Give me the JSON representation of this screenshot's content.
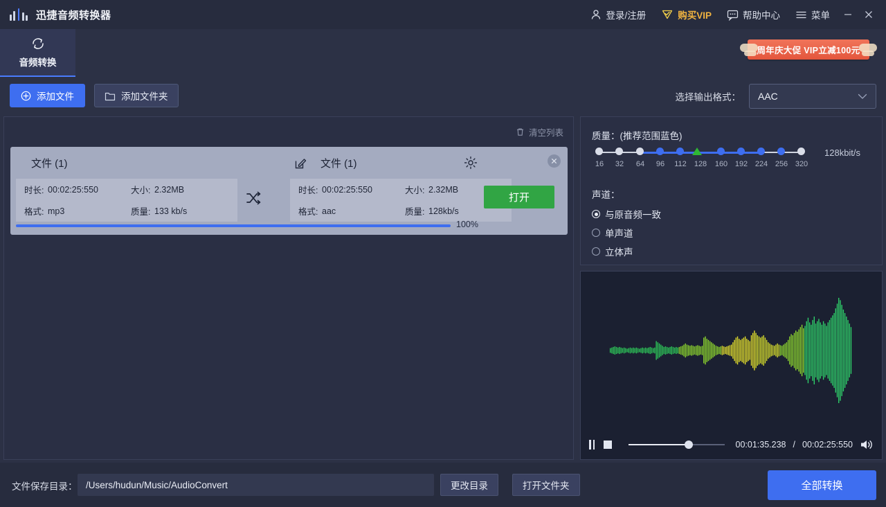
{
  "titlebar": {
    "app_title": "迅捷音频转换器",
    "login": "登录/注册",
    "vip": "购买VIP",
    "help": "帮助中心",
    "menu": "菜单",
    "minimize": "—",
    "close": "✕"
  },
  "tabs": [
    {
      "label": "音频转换",
      "icon": "refresh-icon",
      "active": true
    }
  ],
  "promo": {
    "text": "周年庆大促 VIP立减100元"
  },
  "actionbar": {
    "add_file": "添加文件",
    "add_folder": "添加文件夹",
    "format_label": "选择输出格式：",
    "format_value": "AAC"
  },
  "list_panel": {
    "clear_list": "清空列表",
    "file_card": {
      "source_title": "文件 (1)",
      "target_title": "文件 (1)",
      "labels": {
        "duration": "时长:",
        "size": "大小:",
        "format": "格式:",
        "quality": "质量:"
      },
      "source": {
        "duration": "00:02:25:550",
        "size": "2.32MB",
        "format": "mp3",
        "quality": "133 kb/s"
      },
      "target": {
        "duration": "00:02:25:550",
        "size": "2.32MB",
        "format": "aac",
        "quality": "128kb/s"
      },
      "open_button": "打开",
      "progress_text": "100%",
      "progress_value": 100
    }
  },
  "settings": {
    "quality_title": "质量：(推荐范围蓝色)",
    "bitrate_value": "128kbit/s",
    "ticks": [
      "16",
      "32",
      "64",
      "96",
      "112",
      "128",
      "160",
      "192",
      "224",
      "256",
      "320"
    ],
    "selected_tick_index": 5,
    "recommended_range": [
      3,
      9
    ],
    "channel_title": "声道：",
    "channels": [
      {
        "label": "与原音频一致",
        "selected": true
      },
      {
        "label": "单声道",
        "selected": false
      },
      {
        "label": "立体声",
        "selected": false
      }
    ]
  },
  "player": {
    "current_time": "00:01:35.238",
    "separator": "/",
    "total_time": "00:02:25:550",
    "progress_percent": 63
  },
  "bottombar": {
    "save_label": "文件保存目录：",
    "save_path": "/Users/hudun/Music/AudioConvert",
    "change_dir": "更改目录",
    "open_folder": "打开文件夹",
    "convert_all": "全部转换"
  },
  "colors": {
    "accent_blue": "#3e6ef0",
    "green": "#31a544",
    "vip_gold": "#f0b340",
    "promo_red": "#e4563c",
    "bg_dark": "#2c3145",
    "panel_dark": "#2a2f44",
    "card_gray": "#a4abc0"
  },
  "chart_data": {
    "type": "area",
    "title": "audio-waveform",
    "values": [
      4,
      5,
      6,
      7,
      6,
      5,
      6,
      5,
      4,
      5,
      4,
      3,
      4,
      5,
      4,
      5,
      4,
      5,
      4,
      3,
      4,
      5,
      4,
      5,
      4,
      5,
      6,
      5,
      4,
      5,
      16,
      14,
      12,
      10,
      8,
      6,
      7,
      6,
      5,
      6,
      7,
      6,
      5,
      6,
      5,
      6,
      7,
      8,
      10,
      12,
      10,
      9,
      8,
      9,
      8,
      7,
      8,
      9,
      8,
      7,
      8,
      22,
      24,
      20,
      18,
      16,
      14,
      12,
      10,
      8,
      7,
      6,
      7,
      8,
      7,
      6,
      7,
      8,
      9,
      10,
      14,
      18,
      22,
      24,
      20,
      18,
      20,
      22,
      24,
      20,
      18,
      16,
      26,
      30,
      34,
      30,
      26,
      24,
      22,
      24,
      26,
      22,
      18,
      14,
      12,
      10,
      9,
      8,
      10,
      12,
      10,
      9,
      8,
      10,
      12,
      14,
      18,
      24,
      28,
      26,
      30,
      34,
      32,
      36,
      40,
      44,
      38,
      42,
      50,
      56,
      48,
      44,
      52,
      58,
      46,
      50,
      54,
      48,
      44,
      50,
      46,
      42,
      48,
      52,
      56,
      60,
      64,
      72,
      80,
      90,
      86,
      78,
      70,
      64,
      58,
      52,
      46,
      40
    ]
  }
}
